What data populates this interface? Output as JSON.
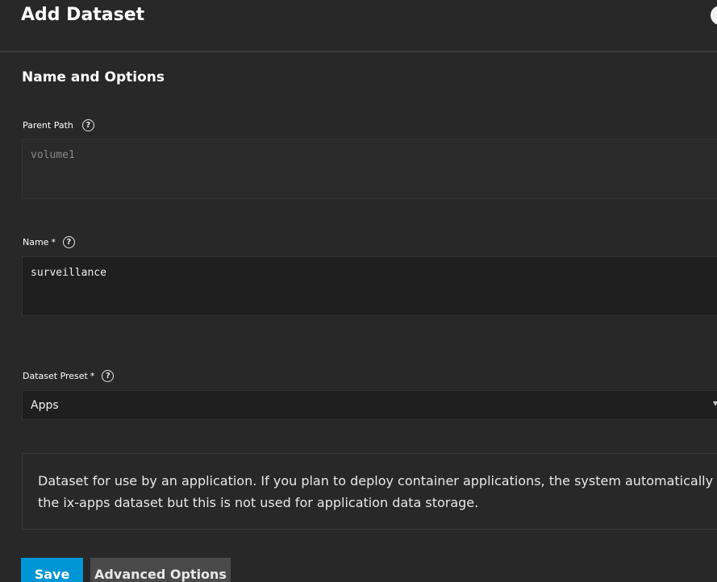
{
  "header": {
    "title": "Add Dataset"
  },
  "section": {
    "title": "Name and Options"
  },
  "parent_path": {
    "label": "Parent Path",
    "help_icon": "help-circle-icon",
    "value": "volume1"
  },
  "name": {
    "label": "Name",
    "required_mark": "*",
    "help_icon": "help-circle-icon",
    "value": "surveillance"
  },
  "preset": {
    "label": "Dataset Preset",
    "required_mark": "*",
    "help_icon": "help-circle-icon",
    "selected": "Apps",
    "arrow_icon": "chevron-down-icon"
  },
  "preset_description": {
    "line1": "Dataset for use by an application. If you plan to deploy container applications, the system automatically creates",
    "line2": "the ix-apps dataset but this is not used for application data storage."
  },
  "actions": {
    "save_label": "Save",
    "advanced_label": "Advanced Options"
  },
  "colors": {
    "background": "#282828",
    "input_background": "#1f1f1f",
    "primary": "#0095d5",
    "secondary_button": "#4a4a4a"
  }
}
